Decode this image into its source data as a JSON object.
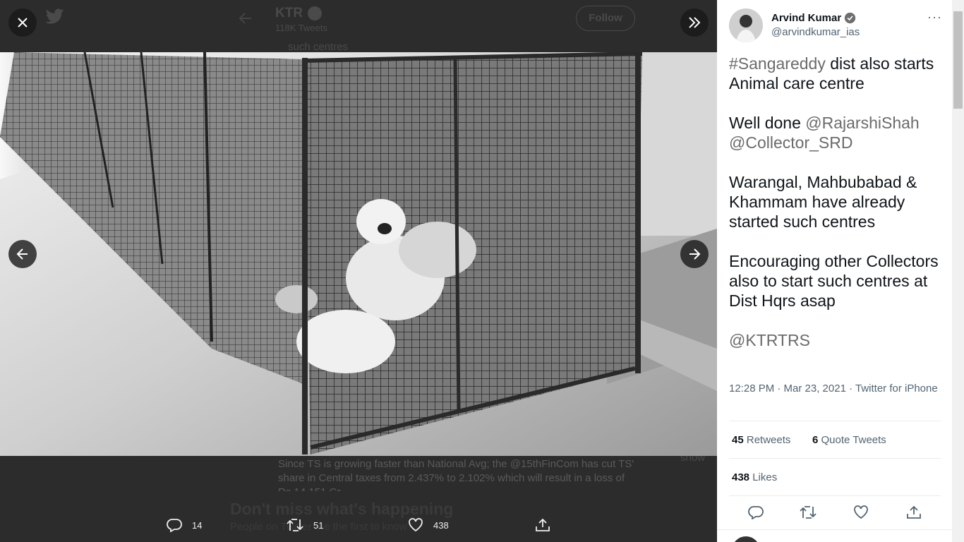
{
  "background": {
    "profile_name": "KTR",
    "tweet_count": "118K Tweets",
    "follow_label": "Follow",
    "prev_text": "such centres",
    "body_text": "Since TS is growing faster than National Avg; the @15thFinCom has cut TS' share in Central taxes from 2.437% to 2.102% which will result in a loss of Rs 14,151 Cr",
    "side_text": "show",
    "banner_title": "Don't miss what's happening",
    "banner_sub": "People on Twitter are the first to know."
  },
  "media": {
    "close_icon": "close-icon",
    "collapse_icon": "double-chevron-right-icon",
    "prev_icon": "arrow-left-icon",
    "next_icon": "arrow-right-icon"
  },
  "actions": {
    "replies": "14",
    "retweets": "51",
    "likes": "438"
  },
  "tweet": {
    "author_name": "Arvind Kumar",
    "author_handle": "@arvindkumar_ias",
    "more_label": "···",
    "line1_link": "#Sangareddy",
    "line1_rest": " dist also starts Animal care centre",
    "line2_prefix": "Well done ",
    "line2_link1": "@RajarshiShah",
    "line2_link2": "@Collector_SRD",
    "line3": "Warangal, Mahbubabad & Khammam have already started such centres",
    "line4": "Encouraging other Collectors also to start such centres at Dist Hqrs asap",
    "line5_link": "@KTRTRS",
    "time": "12:28 PM · Mar 23, 2021 · Twitter for iPhone",
    "retweets_count": "45",
    "retweets_label": "Retweets",
    "quotes_count": "6",
    "quotes_label": "Quote Tweets",
    "likes_count": "438",
    "likes_label": "Likes"
  }
}
